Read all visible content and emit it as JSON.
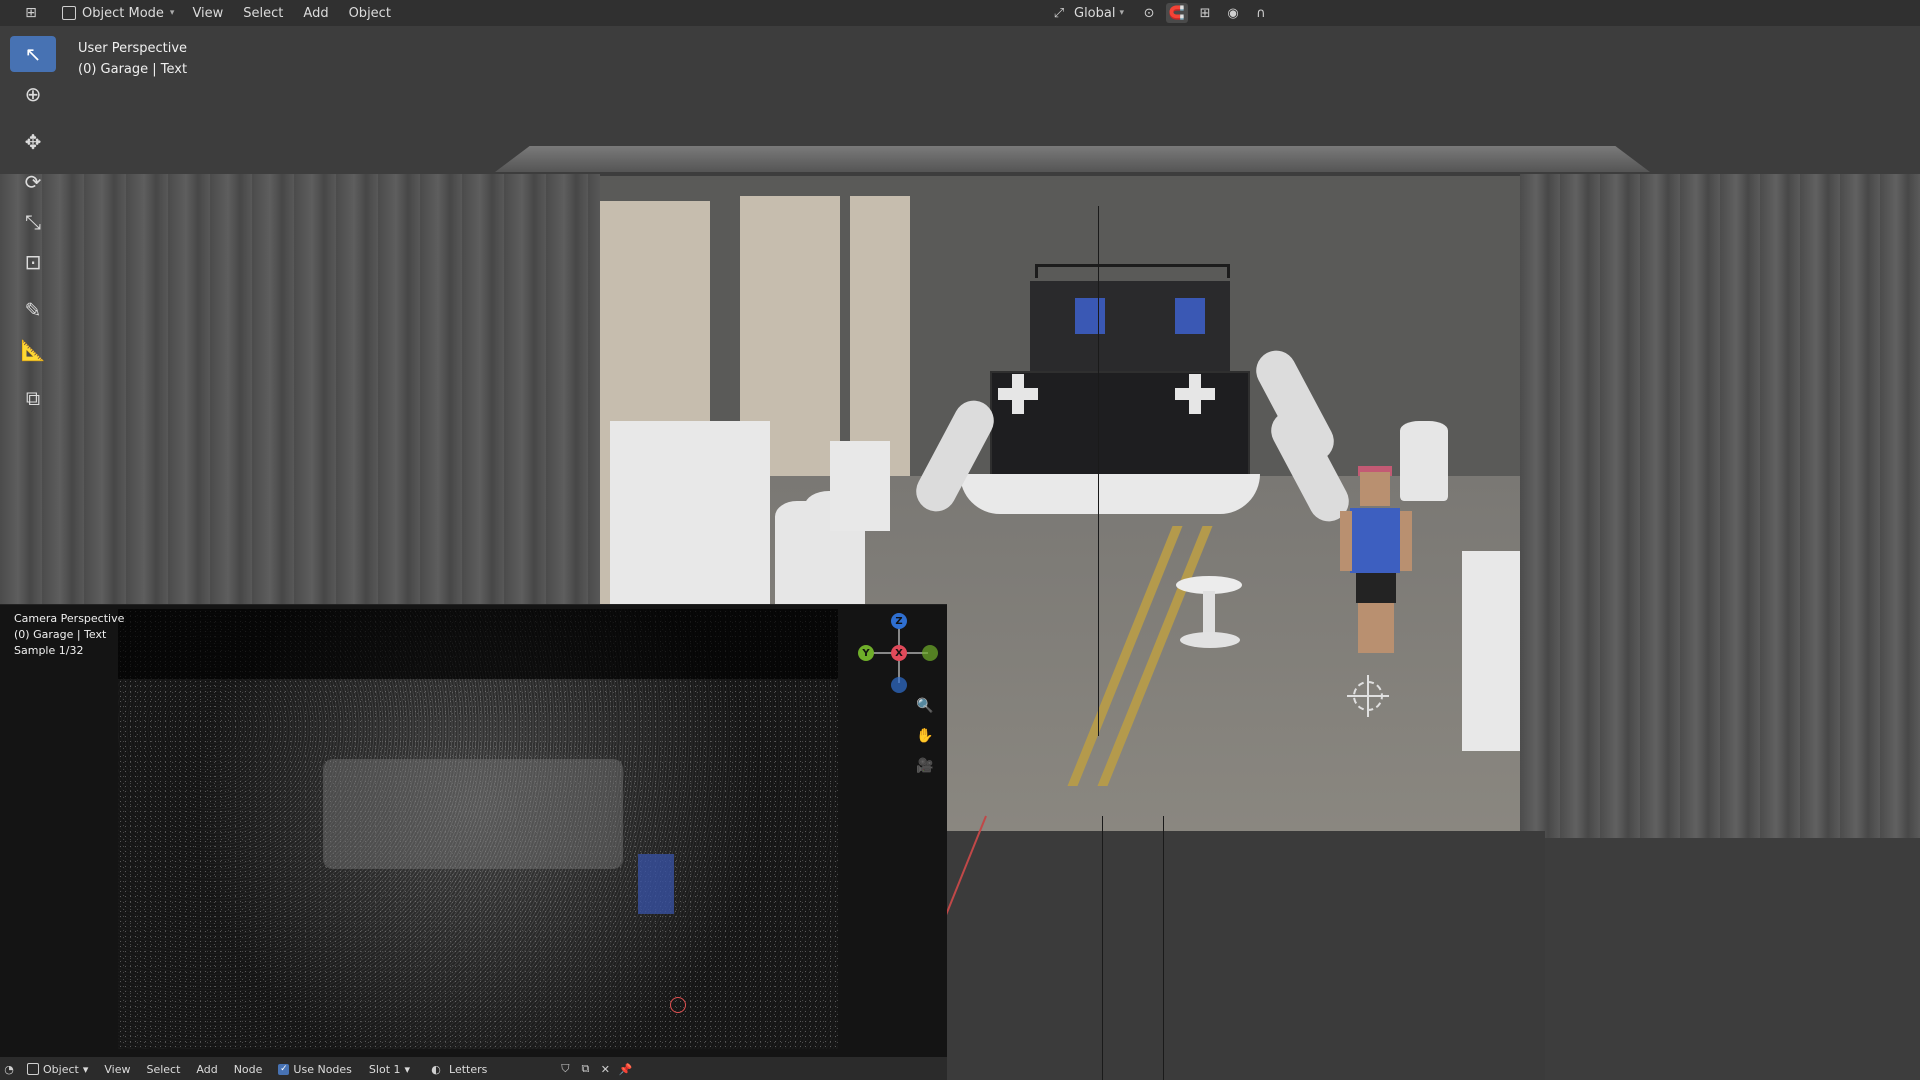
{
  "header": {
    "mode": "Object Mode",
    "menus": [
      "View",
      "Select",
      "Add",
      "Object"
    ],
    "orientation": "Global"
  },
  "viewport": {
    "perspective": "User Perspective",
    "collection": "(0) Garage | Text"
  },
  "camera_view": {
    "perspective": "Camera Perspective",
    "collection": "(0) Garage | Text",
    "sample": "Sample 1/32",
    "gizmo": {
      "z": "Z",
      "y": "Y",
      "x": "X"
    }
  },
  "camera_footer": {
    "mode": "Object",
    "menus": [
      "View",
      "Select",
      "Add",
      "Node"
    ],
    "use_nodes_label": "Use Nodes",
    "slot": "Slot 1",
    "material": "Letters"
  },
  "colors": {
    "accent": "#4772b3",
    "header_bg": "#303030",
    "viewport_bg": "#3d3d3d"
  },
  "icons": {
    "toolbar": [
      "select-box-icon",
      "cursor-icon",
      "move-icon",
      "rotate-icon",
      "scale-icon",
      "transform-icon",
      "annotate-icon",
      "measure-icon",
      "add-cube-icon"
    ]
  }
}
